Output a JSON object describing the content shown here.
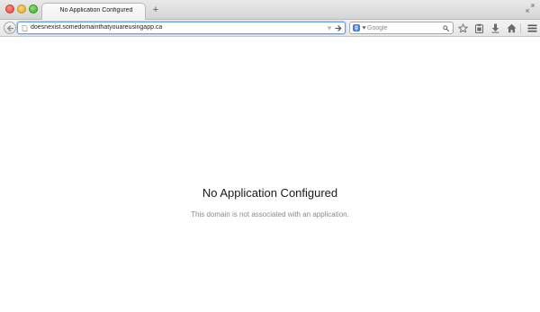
{
  "browser": {
    "tab": {
      "title": "No Application Configured"
    },
    "new_tab_label": "+",
    "url": "doesnexist.somedomainthatyouareusingapp.ca",
    "search": {
      "placeholder": "Google",
      "engine_letter": "g"
    },
    "icons": {
      "back": "back-arrow-icon",
      "site": "page-icon",
      "go": "go-arrow-icon",
      "bookmark": "star-icon",
      "clipboard": "clipboard-icon",
      "download": "download-icon",
      "home": "home-icon",
      "menu": "hamburger-menu-icon"
    },
    "accent_color": "#6aa0e0"
  },
  "page": {
    "heading": "No Application Configured",
    "message": "This domain is not associated with an application."
  }
}
